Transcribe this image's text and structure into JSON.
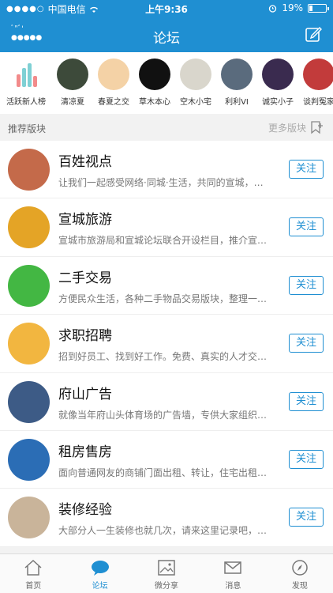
{
  "status": {
    "carrier": "中国电信",
    "signal_dots": "●●●●○",
    "time": "上午9:36",
    "battery_label": "19%"
  },
  "nav": {
    "title": "论坛",
    "user_line1": "ﾞ\"ﾞ'",
    "user_line2": "●●●●●"
  },
  "strip": [
    {
      "label": "活跃新人榜",
      "color": "#ffffff"
    },
    {
      "label": "清凉夏",
      "color": "#3d4a3a"
    },
    {
      "label": "春夏之交",
      "color": "#f4d2a6"
    },
    {
      "label": "草木本心",
      "color": "#111111"
    },
    {
      "label": "空木小宅",
      "color": "#d9d6cc"
    },
    {
      "label": "利利VI",
      "color": "#5a6b7d"
    },
    {
      "label": "诚实小子",
      "color": "#3a2b4f"
    },
    {
      "label": "谈判冤家",
      "color": "#c23b3b"
    }
  ],
  "section": {
    "title": "推荐版块",
    "more": "更多版块"
  },
  "boards": [
    {
      "name": "百姓视点",
      "desc": "让我们一起感受网络·同城·生活，共同的宣城，…",
      "follow": "关注",
      "color": "#c46a4a"
    },
    {
      "name": "宣城旅游",
      "desc": "宣城市旅游局和宣城论坛联合开设栏目，推介宣…",
      "follow": "关注",
      "color": "#e4a426"
    },
    {
      "name": "二手交易",
      "desc": "方便民众生活，各种二手物品交易版块，整理一…",
      "follow": "关注",
      "color": "#43b743"
    },
    {
      "name": "求职招聘",
      "desc": "招到好员工、找到好工作。免费、真实的人才交…",
      "follow": "关注",
      "color": "#f2b640"
    },
    {
      "name": "府山广告",
      "desc": "就像当年府山头体育场的广告墙，专供大家组织…",
      "follow": "关注",
      "color": "#3d5b86"
    },
    {
      "name": "租房售房",
      "desc": "面向普通网友的商铺门面出租、转让，住宅出租…",
      "follow": "关注",
      "color": "#2b6db5"
    },
    {
      "name": "装修经验",
      "desc": "大部分人一生装修也就几次，请来这里记录吧，…",
      "follow": "关注",
      "color": "#c9b49a"
    }
  ],
  "tabs": [
    {
      "label": "首页",
      "icon": "home-icon"
    },
    {
      "label": "论坛",
      "icon": "chat-icon"
    },
    {
      "label": "微分享",
      "icon": "image-icon"
    },
    {
      "label": "消息",
      "icon": "mail-icon"
    },
    {
      "label": "发现",
      "icon": "compass-icon"
    }
  ]
}
